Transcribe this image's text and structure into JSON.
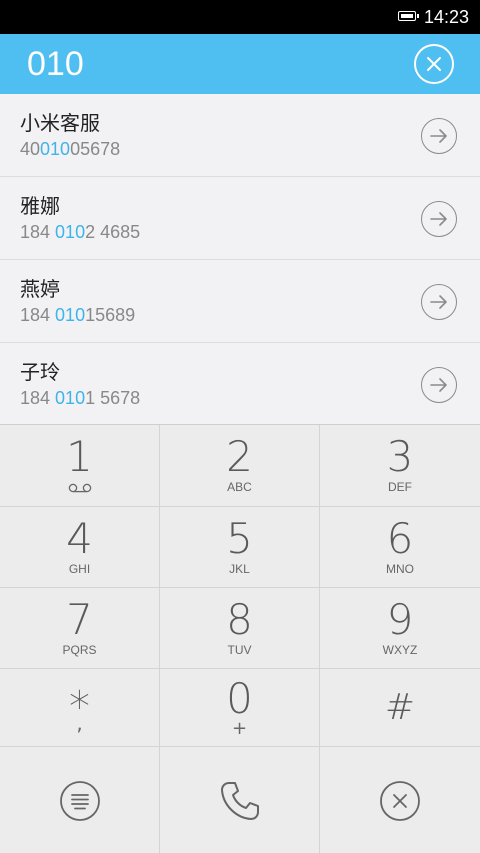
{
  "status_bar": {
    "time": "14:23",
    "battery_icon": "battery-full-icon"
  },
  "dialer": {
    "number": "010",
    "clear_icon": "clear-circle-icon"
  },
  "results": [
    {
      "name": "小米客服",
      "number_prefix": "40",
      "number_match": "010",
      "number_suffix": "05678"
    },
    {
      "name": "雅娜",
      "number_prefix": "184 ",
      "number_match": "010",
      "number_suffix": "2 4685"
    },
    {
      "name": "燕婷",
      "number_prefix": "184 ",
      "number_match": "010",
      "number_suffix": "15689"
    },
    {
      "name": "子玲",
      "number_prefix": "184 ",
      "number_match": "010",
      "number_suffix": "1 5678"
    }
  ],
  "keypad": {
    "keys": [
      {
        "digit": "1",
        "letters": ""
      },
      {
        "digit": "2",
        "letters": "ABC"
      },
      {
        "digit": "3",
        "letters": "DEF"
      },
      {
        "digit": "4",
        "letters": "GHI"
      },
      {
        "digit": "5",
        "letters": "JKL"
      },
      {
        "digit": "6",
        "letters": "MNO"
      },
      {
        "digit": "7",
        "letters": "PQRS"
      },
      {
        "digit": "8",
        "letters": "TUV"
      },
      {
        "digit": "9",
        "letters": "WXYZ"
      },
      {
        "digit": "*",
        "letters": ","
      },
      {
        "digit": "0",
        "letters": "+"
      },
      {
        "digit": "#",
        "letters": ""
      }
    ]
  },
  "bottom_actions": [
    "menu-icon",
    "phone-call-icon",
    "delete-icon"
  ],
  "colors": {
    "accent": "#4fbef0",
    "match_highlight": "#3db4ec",
    "status_bar": "#000000"
  }
}
